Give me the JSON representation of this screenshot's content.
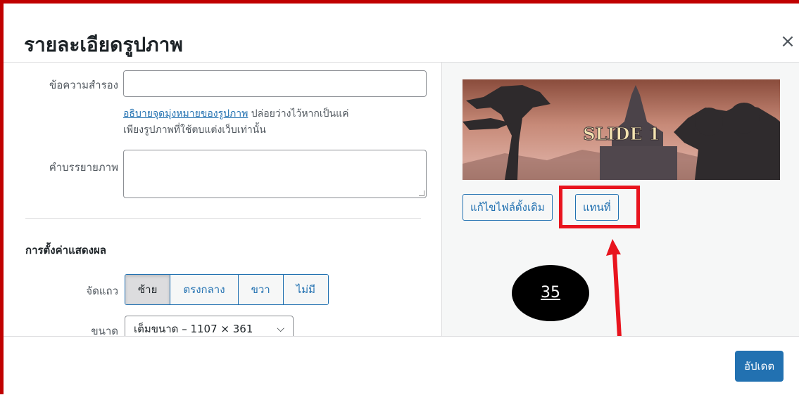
{
  "dialog": {
    "title": "รายละเอียดรูปภาพ",
    "close_icon": "×"
  },
  "fields": {
    "alt_text": {
      "label": "ข้อความสำรอง",
      "value": "",
      "help_link": "อธิบายจุดมุ่งหมายของรูปภาพ",
      "help_text_1": " ปล่อยว่างไว้หากเป็นแค่",
      "help_text_2": "เพียงรูปภาพที่ใช้ตบแต่งเว็บเท่านั้น"
    },
    "caption": {
      "label": "คำบรรยายภาพ",
      "value": ""
    }
  },
  "display_settings": {
    "title": "การตั้งค่าแสดงผล",
    "align_label": "จัดแถว",
    "align_options": [
      "ซ้าย",
      "ตรงกลาง",
      "ขวา",
      "ไม่มี"
    ],
    "align_selected": "ซ้าย",
    "size_label": "ขนาด",
    "size_value": "เต็มขนาด – 1107 × 361"
  },
  "preview": {
    "image_text": "SLIDE 1",
    "edit_original_button": "แก้ไขไฟล์ดั้งเดิม",
    "replace_button": "แทนที่"
  },
  "annotation": {
    "badge_number": "35",
    "highlight_color": "#e8141e",
    "badge_color": "#000000"
  },
  "footer": {
    "update_button": "อัปเดต"
  },
  "colors": {
    "accent": "#2271b1",
    "frame": "#c00000"
  },
  "icons": {
    "close": "close-icon",
    "dropdown": "chevron-down-icon",
    "arrow": "arrow-up-icon"
  }
}
